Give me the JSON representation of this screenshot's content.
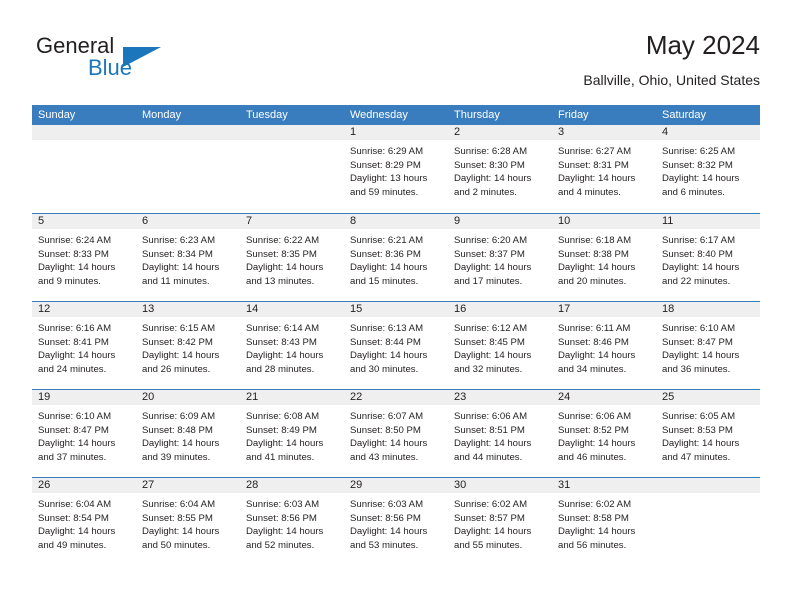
{
  "brand": {
    "name_primary": "General",
    "name_secondary": "Blue",
    "icon": "triangle-logo-icon",
    "color_primary": "#231f20",
    "color_secondary": "#1b76bb"
  },
  "header": {
    "title": "May 2024",
    "subtitle": "Ballville, Ohio, United States"
  },
  "theme": {
    "header_blue": "#3a7dbf",
    "band_gray": "#efefef",
    "text": "#231f20",
    "background": "#ffffff"
  },
  "calendar": {
    "weekday_headers": [
      "Sunday",
      "Monday",
      "Tuesday",
      "Wednesday",
      "Thursday",
      "Friday",
      "Saturday"
    ],
    "weeks": [
      [
        {
          "day": "",
          "lines": []
        },
        {
          "day": "",
          "lines": []
        },
        {
          "day": "",
          "lines": []
        },
        {
          "day": "1",
          "lines": [
            "Sunrise: 6:29 AM",
            "Sunset: 8:29 PM",
            "Daylight: 13 hours",
            "and 59 minutes."
          ]
        },
        {
          "day": "2",
          "lines": [
            "Sunrise: 6:28 AM",
            "Sunset: 8:30 PM",
            "Daylight: 14 hours",
            "and 2 minutes."
          ]
        },
        {
          "day": "3",
          "lines": [
            "Sunrise: 6:27 AM",
            "Sunset: 8:31 PM",
            "Daylight: 14 hours",
            "and 4 minutes."
          ]
        },
        {
          "day": "4",
          "lines": [
            "Sunrise: 6:25 AM",
            "Sunset: 8:32 PM",
            "Daylight: 14 hours",
            "and 6 minutes."
          ]
        }
      ],
      [
        {
          "day": "5",
          "lines": [
            "Sunrise: 6:24 AM",
            "Sunset: 8:33 PM",
            "Daylight: 14 hours",
            "and 9 minutes."
          ]
        },
        {
          "day": "6",
          "lines": [
            "Sunrise: 6:23 AM",
            "Sunset: 8:34 PM",
            "Daylight: 14 hours",
            "and 11 minutes."
          ]
        },
        {
          "day": "7",
          "lines": [
            "Sunrise: 6:22 AM",
            "Sunset: 8:35 PM",
            "Daylight: 14 hours",
            "and 13 minutes."
          ]
        },
        {
          "day": "8",
          "lines": [
            "Sunrise: 6:21 AM",
            "Sunset: 8:36 PM",
            "Daylight: 14 hours",
            "and 15 minutes."
          ]
        },
        {
          "day": "9",
          "lines": [
            "Sunrise: 6:20 AM",
            "Sunset: 8:37 PM",
            "Daylight: 14 hours",
            "and 17 minutes."
          ]
        },
        {
          "day": "10",
          "lines": [
            "Sunrise: 6:18 AM",
            "Sunset: 8:38 PM",
            "Daylight: 14 hours",
            "and 20 minutes."
          ]
        },
        {
          "day": "11",
          "lines": [
            "Sunrise: 6:17 AM",
            "Sunset: 8:40 PM",
            "Daylight: 14 hours",
            "and 22 minutes."
          ]
        }
      ],
      [
        {
          "day": "12",
          "lines": [
            "Sunrise: 6:16 AM",
            "Sunset: 8:41 PM",
            "Daylight: 14 hours",
            "and 24 minutes."
          ]
        },
        {
          "day": "13",
          "lines": [
            "Sunrise: 6:15 AM",
            "Sunset: 8:42 PM",
            "Daylight: 14 hours",
            "and 26 minutes."
          ]
        },
        {
          "day": "14",
          "lines": [
            "Sunrise: 6:14 AM",
            "Sunset: 8:43 PM",
            "Daylight: 14 hours",
            "and 28 minutes."
          ]
        },
        {
          "day": "15",
          "lines": [
            "Sunrise: 6:13 AM",
            "Sunset: 8:44 PM",
            "Daylight: 14 hours",
            "and 30 minutes."
          ]
        },
        {
          "day": "16",
          "lines": [
            "Sunrise: 6:12 AM",
            "Sunset: 8:45 PM",
            "Daylight: 14 hours",
            "and 32 minutes."
          ]
        },
        {
          "day": "17",
          "lines": [
            "Sunrise: 6:11 AM",
            "Sunset: 8:46 PM",
            "Daylight: 14 hours",
            "and 34 minutes."
          ]
        },
        {
          "day": "18",
          "lines": [
            "Sunrise: 6:10 AM",
            "Sunset: 8:47 PM",
            "Daylight: 14 hours",
            "and 36 minutes."
          ]
        }
      ],
      [
        {
          "day": "19",
          "lines": [
            "Sunrise: 6:10 AM",
            "Sunset: 8:47 PM",
            "Daylight: 14 hours",
            "and 37 minutes."
          ]
        },
        {
          "day": "20",
          "lines": [
            "Sunrise: 6:09 AM",
            "Sunset: 8:48 PM",
            "Daylight: 14 hours",
            "and 39 minutes."
          ]
        },
        {
          "day": "21",
          "lines": [
            "Sunrise: 6:08 AM",
            "Sunset: 8:49 PM",
            "Daylight: 14 hours",
            "and 41 minutes."
          ]
        },
        {
          "day": "22",
          "lines": [
            "Sunrise: 6:07 AM",
            "Sunset: 8:50 PM",
            "Daylight: 14 hours",
            "and 43 minutes."
          ]
        },
        {
          "day": "23",
          "lines": [
            "Sunrise: 6:06 AM",
            "Sunset: 8:51 PM",
            "Daylight: 14 hours",
            "and 44 minutes."
          ]
        },
        {
          "day": "24",
          "lines": [
            "Sunrise: 6:06 AM",
            "Sunset: 8:52 PM",
            "Daylight: 14 hours",
            "and 46 minutes."
          ]
        },
        {
          "day": "25",
          "lines": [
            "Sunrise: 6:05 AM",
            "Sunset: 8:53 PM",
            "Daylight: 14 hours",
            "and 47 minutes."
          ]
        }
      ],
      [
        {
          "day": "26",
          "lines": [
            "Sunrise: 6:04 AM",
            "Sunset: 8:54 PM",
            "Daylight: 14 hours",
            "and 49 minutes."
          ]
        },
        {
          "day": "27",
          "lines": [
            "Sunrise: 6:04 AM",
            "Sunset: 8:55 PM",
            "Daylight: 14 hours",
            "and 50 minutes."
          ]
        },
        {
          "day": "28",
          "lines": [
            "Sunrise: 6:03 AM",
            "Sunset: 8:56 PM",
            "Daylight: 14 hours",
            "and 52 minutes."
          ]
        },
        {
          "day": "29",
          "lines": [
            "Sunrise: 6:03 AM",
            "Sunset: 8:56 PM",
            "Daylight: 14 hours",
            "and 53 minutes."
          ]
        },
        {
          "day": "30",
          "lines": [
            "Sunrise: 6:02 AM",
            "Sunset: 8:57 PM",
            "Daylight: 14 hours",
            "and 55 minutes."
          ]
        },
        {
          "day": "31",
          "lines": [
            "Sunrise: 6:02 AM",
            "Sunset: 8:58 PM",
            "Daylight: 14 hours",
            "and 56 minutes."
          ]
        },
        {
          "day": "",
          "lines": []
        }
      ]
    ]
  }
}
